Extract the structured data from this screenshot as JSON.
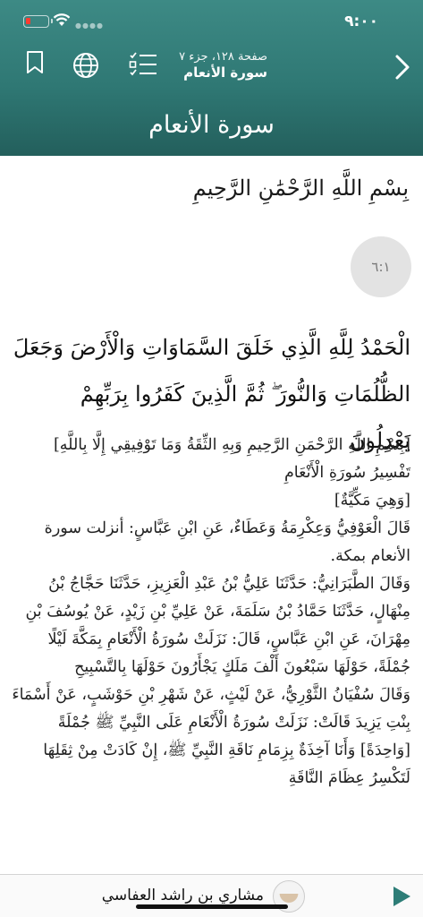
{
  "status": {
    "time": "٩:٠٠",
    "battery_level": 0.15,
    "battery_color": "#ff3b30"
  },
  "toolbar": {
    "icons": [
      "bookmark-icon",
      "globe-icon",
      "list-icon",
      "chevron-right-icon"
    ],
    "page_info": "صفحة ١٢٨، جزء ٧",
    "sura_name": "سورة الأنعام"
  },
  "header": {
    "sura_title": "سورة الأنعام",
    "color": "#2f7874"
  },
  "content": {
    "basmala": "بِسْمِ اللَّهِ الرَّحْمَٰنِ الرَّحِيمِ",
    "ayah_number": "٦:١",
    "verse_lines": [
      "الْحَمْدُ لِلَّهِ الَّذِي خَلَقَ السَّمَاوَاتِ وَالْأَرْضَ وَجَعَلَ",
      "الظُّلُمَاتِ وَالنُّورَ ۖ ثُمَّ الَّذِينَ كَفَرُوا بِرَبِّهِمْ يَعْدِلُونَ"
    ],
    "tafsir_lines": [
      "[بِسْمِ اللَّهِ الرَّحْمَنِ الرَّحِيمِ وَبِهِ الثِّقَةُ وَمَا تَوْفِيقِي إِلَّا بِاللَّهِ]",
      "تَفْسِيرُ سُورَةِ الْأَنْعَامِ",
      "[وَهِيَ مَكِّيَّةٌ]",
      "قَالَ الْعَوْفِيُّ وَعِكْرِمَةُ وَعَطَاءٌ، عَنِ ابْنِ عَبَّاسٍ: أنزلت سورة الأنعام بمكة.",
      "وَقَالَ الطَّبَرَانِيُّ: حَدَّثَنَا عَلِيُّ بْنُ عَبْدِ الْعَزِيزِ، حَدَّثَنَا حَجَّاجُ بْنُ مِنْهَالٍ، حَدَّثَنَا حَمَّادُ بْنُ سَلَمَةَ، عَنْ عَلِيِّ بْنِ زَيْدٍ، عَنْ يُوسُفَ بْنِ مِهْرَانَ، عَنِ ابْنِ عَبَّاسٍ، قَالَ: نَزَلَتْ سُورَةُ الْأَنْعَامِ بِمَكَّةَ لَيْلًا جُمْلَةً، حَوْلَهَا سَبْعُونَ أَلْفَ مَلَكٍ يَجْأَرُونَ حَوْلَهَا بِالتَّسْبِيحِ",
      "وَقَالَ سُفْيَانُ الثَّوْرِيُّ، عَنْ لَيْثٍ، عَنْ شَهْرِ بْنِ حَوْشَبٍ، عَنْ أَسْمَاءَ بِنْتِ يَزِيدَ قَالَتْ: نَزَلَتْ سُورَةُ الْأَنْعَامِ عَلَى النَّبِيِّ ﷺ جُمْلَةً [وَاحِدَةً] وَأَنَا آخِذَةٌ بِزِمَامِ نَاقَةِ النَّبِيِّ ﷺ، إِنْ كَادَتْ مِنْ ثِقَلِهَا لَتَكْسِرُ عِظَامَ النَّاقَةِ"
    ]
  },
  "player": {
    "reciter": "مشاري بن راشد العفاسي",
    "accent": "#2d7d77"
  }
}
